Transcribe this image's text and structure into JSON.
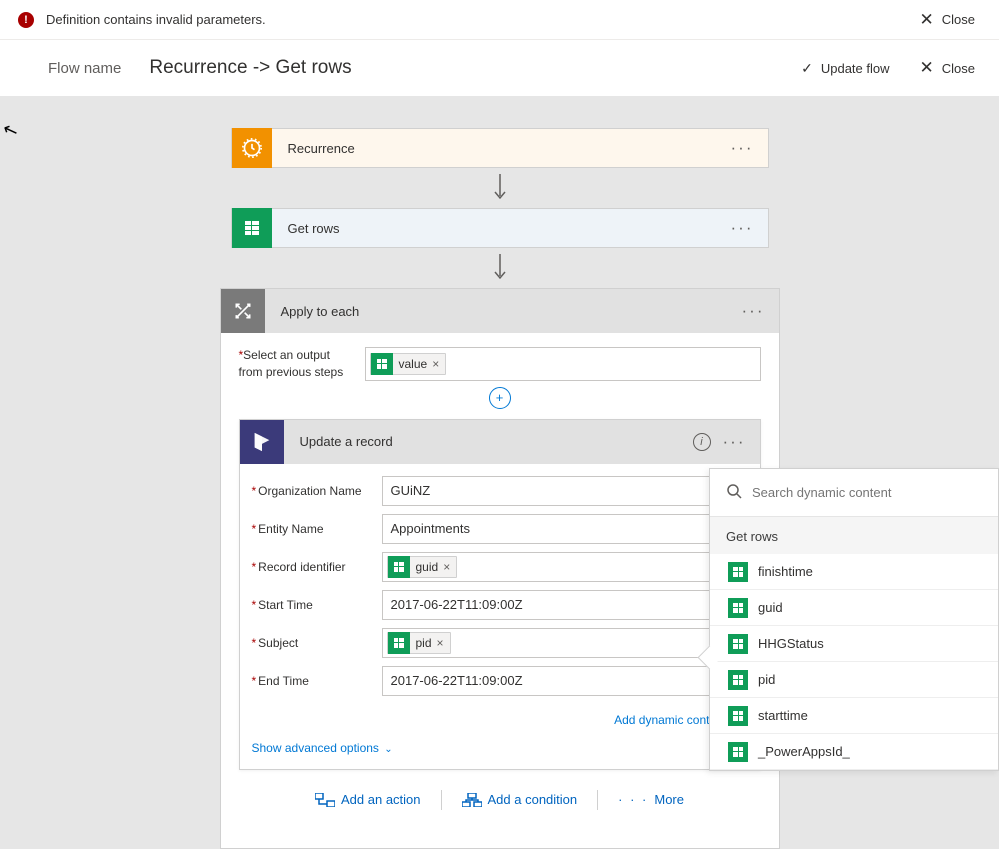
{
  "banner": {
    "message": "Definition contains invalid parameters.",
    "close": "Close"
  },
  "header": {
    "flow_name_label": "Flow name",
    "title": "Recurrence -> Get rows",
    "update": "Update flow",
    "close": "Close"
  },
  "steps": {
    "recurrence": {
      "title": "Recurrence"
    },
    "getrows": {
      "title": "Get rows"
    }
  },
  "apply": {
    "title": "Apply to each",
    "select_label_1": "Select an output",
    "select_label_2": "from previous steps",
    "token": "value"
  },
  "update_card": {
    "title": "Update a record",
    "fields": {
      "org": {
        "label": "Organization Name",
        "value": "GUiNZ"
      },
      "entity": {
        "label": "Entity Name",
        "value": "Appointments"
      },
      "record": {
        "label": "Record identifier",
        "token": "guid"
      },
      "start": {
        "label": "Start Time",
        "value": "2017-06-22T11:09:00Z"
      },
      "subject": {
        "label": "Subject",
        "token": "pid"
      },
      "end": {
        "label": "End Time",
        "value": "2017-06-22T11:09:00Z"
      }
    },
    "dynamic_link": "Add dynamic content",
    "advanced": "Show advanced options"
  },
  "actions": {
    "add_action": "Add an action",
    "add_condition": "Add a condition",
    "more": "More"
  },
  "side_pane": {
    "search_placeholder": "Search dynamic content",
    "section": "Get rows",
    "items": [
      "finishtime",
      "guid",
      "HHGStatus",
      "pid",
      "starttime",
      "_PowerAppsId_"
    ]
  }
}
